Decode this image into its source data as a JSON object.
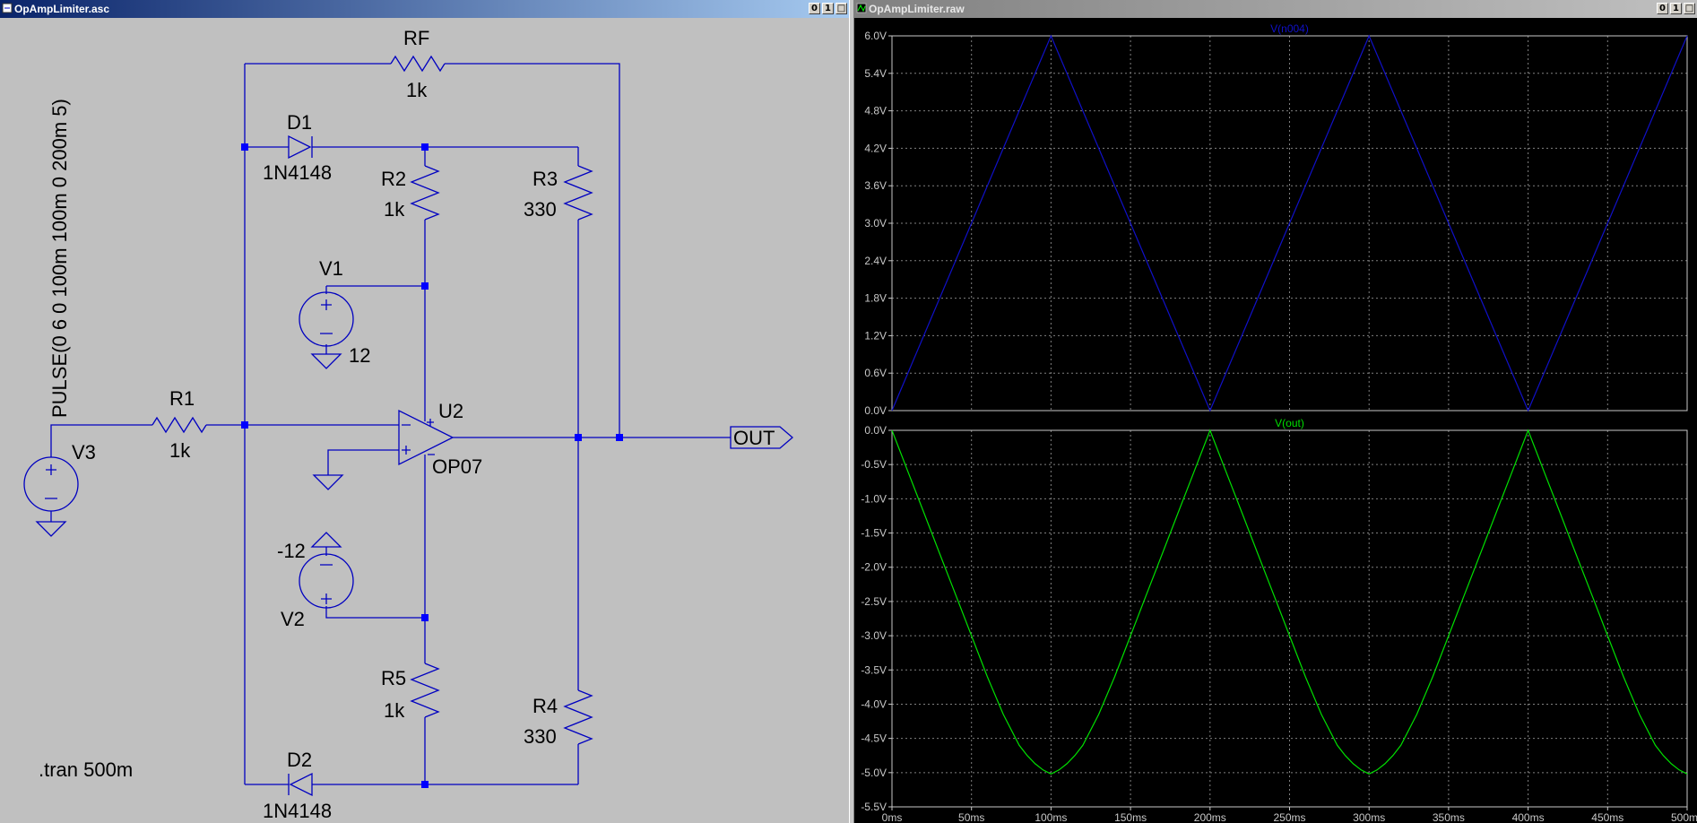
{
  "schematic_window": {
    "title": "OpAmpLimiter.asc",
    "buttons": {
      "minimize": "0",
      "restore": "1",
      "maximize": "□"
    },
    "labels": {
      "rf_name": "RF",
      "rf_value": "1k",
      "d1_name": "D1",
      "d1_value": "1N4148",
      "r2_name": "R2",
      "r2_value": "1k",
      "r3_name": "R3",
      "r3_value": "330",
      "v1_name": "V1",
      "v1_value": "12",
      "r1_name": "R1",
      "r1_value": "1k",
      "u2_name": "U2",
      "u2_value": "OP07",
      "v3_name": "V3",
      "v3_value": "PULSE(0 6 0 100m 100m 0 200m 5)",
      "v2_name": "V2",
      "v2_value": "-12",
      "r5_name": "R5",
      "r5_value": "1k",
      "r4_name": "R4",
      "r4_value": "330",
      "d2_name": "D2",
      "d2_value": "1N4148",
      "out_label": "OUT",
      "directive": ".tran 500m"
    },
    "colors": {
      "wire": "#0000c0",
      "text": "#000000",
      "background": "#c0c0c0"
    }
  },
  "plot_window": {
    "title": "OpAmpLimiter.raw",
    "buttons": {
      "minimize": "0",
      "restore": "1",
      "maximize": "□"
    },
    "chart_data": [
      {
        "type": "line",
        "title": "V(n004)",
        "color": "#1010c8",
        "ylim": [
          0,
          6.0
        ],
        "yticks": [
          "6.0V",
          "5.4V",
          "4.8V",
          "4.2V",
          "3.6V",
          "3.0V",
          "2.4V",
          "1.8V",
          "1.2V",
          "0.6V",
          "0.0V"
        ],
        "xlim": [
          0,
          500
        ],
        "x_unit": "ms",
        "x": [
          0,
          100,
          200,
          300,
          400,
          500
        ],
        "y": [
          0,
          6.0,
          0,
          6.0,
          0,
          6.0
        ]
      },
      {
        "type": "line",
        "title": "V(out)",
        "color": "#00e000",
        "ylim": [
          -5.5,
          0.0
        ],
        "yticks": [
          "0.0V",
          "-0.5V",
          "-1.0V",
          "-1.5V",
          "-2.0V",
          "-2.5V",
          "-3.0V",
          "-3.5V",
          "-4.0V",
          "-4.5V",
          "-5.0V",
          "-5.5V"
        ],
        "xlim": [
          0,
          500
        ],
        "x_unit": "ms",
        "xticks": [
          "0ms",
          "50ms",
          "100ms",
          "150ms",
          "200ms",
          "250ms",
          "300ms",
          "350ms",
          "400ms",
          "450ms",
          "500ms"
        ],
        "x": [
          0,
          10,
          20,
          30,
          40,
          50,
          60,
          70,
          80,
          85,
          90,
          95,
          100,
          105,
          110,
          115,
          120,
          130,
          140,
          150,
          160,
          170,
          180,
          190,
          200,
          210,
          220,
          230,
          240,
          250,
          260,
          270,
          280,
          285,
          290,
          295,
          300,
          305,
          310,
          315,
          320,
          330,
          340,
          350,
          360,
          370,
          380,
          390,
          400,
          410,
          420,
          430,
          440,
          450,
          460,
          470,
          480,
          485,
          490,
          495,
          500
        ],
        "y": [
          0,
          -0.6,
          -1.2,
          -1.8,
          -2.4,
          -3.0,
          -3.6,
          -4.15,
          -4.6,
          -4.75,
          -4.87,
          -4.96,
          -5.02,
          -4.96,
          -4.87,
          -4.75,
          -4.6,
          -4.15,
          -3.6,
          -3.0,
          -2.4,
          -1.8,
          -1.2,
          -0.6,
          0,
          -0.6,
          -1.2,
          -1.8,
          -2.4,
          -3.0,
          -3.6,
          -4.15,
          -4.6,
          -4.75,
          -4.87,
          -4.96,
          -5.02,
          -4.96,
          -4.87,
          -4.75,
          -4.6,
          -4.15,
          -3.6,
          -3.0,
          -2.4,
          -1.8,
          -1.2,
          -0.6,
          0,
          -0.6,
          -1.2,
          -1.8,
          -2.4,
          -3.0,
          -3.6,
          -4.15,
          -4.6,
          -4.75,
          -4.87,
          -4.96,
          -5.02
        ]
      }
    ],
    "colors": {
      "grid": "#808080",
      "axis_text": "#c8c8c8",
      "frame": "#c8c8c8"
    }
  }
}
